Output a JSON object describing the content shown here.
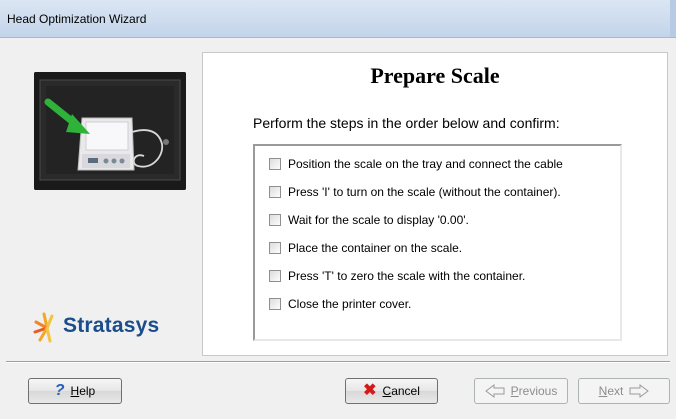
{
  "window": {
    "title": "Head Optimization Wizard"
  },
  "page": {
    "heading": "Prepare Scale",
    "instructions": "Perform the steps in the order below and confirm:"
  },
  "steps": [
    {
      "label": "Position the scale on the tray and connect the cable",
      "checked": false
    },
    {
      "label": "Press 'I' to turn on the scale (without the container).",
      "checked": false
    },
    {
      "label": "Wait for the scale to display '0.00'.",
      "checked": false
    },
    {
      "label": "Place the container on the scale.",
      "checked": false
    },
    {
      "label": "Press 'T' to zero the scale with the container.",
      "checked": false
    },
    {
      "label": "Close the printer cover.",
      "checked": false
    }
  ],
  "logo": {
    "text": "Stratasys"
  },
  "buttons": {
    "help": {
      "pre": "",
      "hot": "H",
      "post": "elp",
      "icon": "help-icon"
    },
    "cancel": {
      "pre": "",
      "hot": "C",
      "post": "ancel",
      "icon": "x-icon"
    },
    "previous": {
      "pre": "",
      "hot": "P",
      "post": "revious",
      "enabled": false
    },
    "next": {
      "pre": "",
      "hot": "N",
      "post": "ext",
      "enabled": false
    }
  },
  "colors": {
    "accent_green": "#2fb23a",
    "logo_text": "#1a4d8c",
    "logo_star_yellow": "#f5a623",
    "cancel_x": "#d11a1a"
  }
}
